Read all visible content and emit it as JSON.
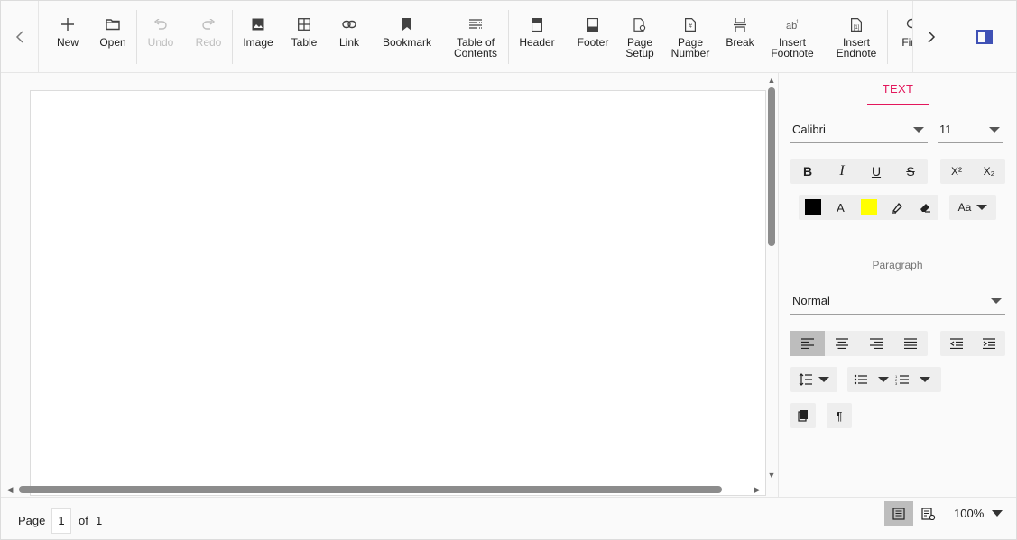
{
  "toolbar": {
    "items": [
      {
        "label": "New",
        "icon": "plus-icon",
        "enabled": true
      },
      {
        "label": "Open",
        "icon": "folder-icon",
        "enabled": true
      },
      {
        "label": "Undo",
        "icon": "undo-icon",
        "enabled": false
      },
      {
        "label": "Redo",
        "icon": "redo-icon",
        "enabled": false
      },
      {
        "label": "Image",
        "icon": "image-icon",
        "enabled": true
      },
      {
        "label": "Table",
        "icon": "table-icon",
        "enabled": true
      },
      {
        "label": "Link",
        "icon": "link-icon",
        "enabled": true
      },
      {
        "label": "Bookmark",
        "icon": "bookmark-icon",
        "enabled": true
      },
      {
        "label": "Table of\nContents",
        "icon": "toc-icon",
        "enabled": true
      },
      {
        "label": "Header",
        "icon": "header-icon",
        "enabled": true
      },
      {
        "label": "Footer",
        "icon": "footer-icon",
        "enabled": true
      },
      {
        "label": "Page\nSetup",
        "icon": "page-setup-icon",
        "enabled": true
      },
      {
        "label": "Page\nNumber",
        "icon": "page-number-icon",
        "enabled": true
      },
      {
        "label": "Break",
        "icon": "break-icon",
        "enabled": true
      },
      {
        "label": "Insert\nFootnote",
        "icon": "footnote-icon",
        "enabled": true
      },
      {
        "label": "Insert\nEndnote",
        "icon": "endnote-icon",
        "enabled": true
      },
      {
        "label": "Find",
        "icon": "search-icon",
        "enabled": true
      }
    ]
  },
  "properties": {
    "tab_label": "TEXT",
    "font_family": "Calibri",
    "font_size": "11",
    "paragraph_title": "Paragraph",
    "paragraph_style": "Normal",
    "font_color": "#000000",
    "highlight_color": "#ffff00",
    "font_color_glyph": "A",
    "change_case_glyph": "Aa",
    "superscript_glyph": "X²",
    "subscript_glyph": "X₂"
  },
  "status": {
    "page_label": "Page",
    "current_page": "1",
    "of_label": "of",
    "total_pages": "1",
    "zoom": "100%"
  },
  "colors": {
    "accent": "#e3165b",
    "pane_toggle": "#3f51b5"
  }
}
